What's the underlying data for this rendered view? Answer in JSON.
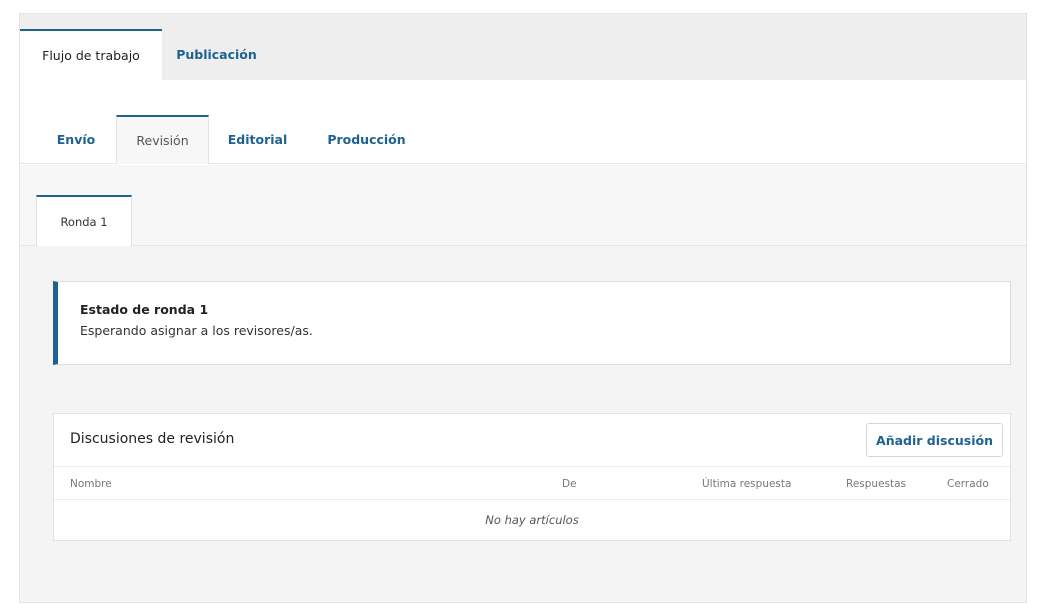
{
  "top_tabs": [
    "Flujo de trabajo",
    "Publicación"
  ],
  "stage_tabs": [
    "Envío",
    "Revisión",
    "Editorial",
    "Producción"
  ],
  "round_tab": "Ronda 1",
  "status": {
    "title": "Estado de ronda 1",
    "text": "Esperando asignar a los revisores/as."
  },
  "discussions": {
    "title": "Discusiones de revisión",
    "add_button": "Añadir discusión",
    "columns": [
      "Nombre",
      "De",
      "Última respuesta",
      "Respuestas",
      "Cerrado"
    ],
    "empty_text": "No hay artículos"
  },
  "colors": {
    "accent": "#1e6292"
  }
}
